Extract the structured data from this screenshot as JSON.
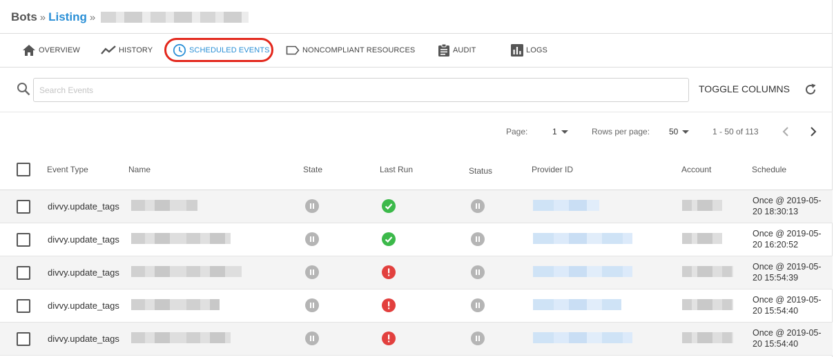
{
  "breadcrumb": {
    "root": "Bots",
    "sep1": "»",
    "link": "Listing",
    "sep2": "»"
  },
  "tabs": [
    {
      "label": "OVERVIEW",
      "icon": "home-icon",
      "active": false
    },
    {
      "label": "HISTORY",
      "icon": "chart-line-icon",
      "active": false
    },
    {
      "label": "SCHEDULED EVENTS",
      "icon": "clock-icon",
      "active": true
    },
    {
      "label": "NONCOMPLIANT RESOURCES",
      "icon": "label-icon",
      "active": false
    },
    {
      "label": "AUDIT",
      "icon": "clipboard-icon",
      "active": false
    },
    {
      "label": "LOGS",
      "icon": "bar-chart-icon",
      "active": false
    }
  ],
  "colors": {
    "accent": "#2a8fd6",
    "highlight": "#e3261b",
    "success": "#3cb94a",
    "error": "#e2403e",
    "paused": "#b5b5b5"
  },
  "search": {
    "placeholder": "Search Events",
    "value": ""
  },
  "toolbar": {
    "toggle_columns": "TOGGLE COLUMNS"
  },
  "pagination": {
    "page_label": "Page:",
    "page_value": "1",
    "rows_label": "Rows per page:",
    "rows_value": "50",
    "range": "1 - 50 of 113"
  },
  "table": {
    "headers": [
      "Event Type",
      "Name",
      "State",
      "Last Run",
      "Status",
      "Provider ID",
      "Account",
      "Schedule"
    ],
    "rows": [
      {
        "event_type": "divvy.update_tags",
        "state": "paused-icon",
        "last_run": "success-icon",
        "status": "paused-icon",
        "schedule_line1": "Once @ 2019-05-",
        "schedule_line2": "20 18:30:13"
      },
      {
        "event_type": "divvy.update_tags",
        "state": "paused-icon",
        "last_run": "success-icon",
        "status": "paused-icon",
        "schedule_line1": "Once @ 2019-05-",
        "schedule_line2": "20 16:20:52"
      },
      {
        "event_type": "divvy.update_tags",
        "state": "paused-icon",
        "last_run": "error-icon",
        "status": "paused-icon",
        "schedule_line1": "Once @ 2019-05-",
        "schedule_line2": "20 15:54:39"
      },
      {
        "event_type": "divvy.update_tags",
        "state": "paused-icon",
        "last_run": "error-icon",
        "status": "paused-icon",
        "schedule_line1": "Once @ 2019-05-",
        "schedule_line2": "20 15:54:40"
      },
      {
        "event_type": "divvy.update_tags",
        "state": "paused-icon",
        "last_run": "error-icon",
        "status": "paused-icon",
        "schedule_line1": "Once @ 2019-05-",
        "schedule_line2": "20 15:54:40"
      }
    ]
  }
}
